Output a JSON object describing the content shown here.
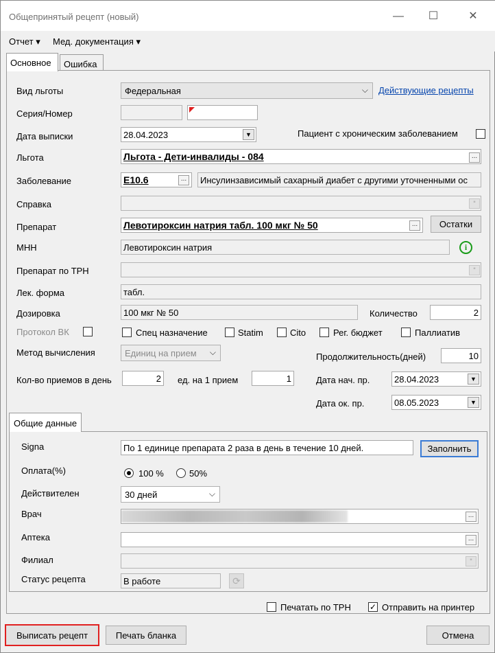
{
  "window": {
    "title": "Общепринятый рецепт (новый)",
    "minimize": "—",
    "maximize": "☐",
    "close": "✕"
  },
  "menu": {
    "report": "Отчет ▾",
    "med_docs": "Мед. документация ▾"
  },
  "tabs": [
    "Основное",
    "Ошибка"
  ],
  "form": {
    "benefit_type_label": "Вид льготы",
    "benefit_type_value": "Федеральная",
    "active_prescriptions_link": "Действующие рецепты",
    "series_number_label": "Серия/Номер",
    "series_value": "",
    "number_value": "",
    "issue_date_label": "Дата выписки",
    "issue_date_value": "28.04.2023",
    "chronic_label": "Пациент с хроническим заболеванием",
    "chronic_checked": false,
    "privilege_label": "Льгота",
    "privilege_value": "Льгота - Дети-инвалиды - 084",
    "disease_label": "Заболевание",
    "disease_code": "E10.6",
    "disease_name": "Инсулинзависимый сахарный диабет с другими уточненными ос",
    "certificate_label": "Справка",
    "certificate_value": "",
    "drug_label": "Препарат",
    "drug_value": "Левотироксин натрия табл. 100 мкг № 50",
    "stock_button": "Остатки",
    "mnn_label": "МНН",
    "mnn_value": "Левотироксин натрия",
    "info_icon": "i",
    "drug_trn_label": "Препарат по ТРН",
    "drug_trn_value": "",
    "dosage_form_label": "Лек. форма",
    "dosage_form_value": "табл.",
    "dosage_label": "Дозировка",
    "dosage_value": "100 мкг № 50",
    "quantity_label": "Количество",
    "quantity_value": "2",
    "vk_protocol_label": "Протокол ВК",
    "special_label": "Спец назначение",
    "statim_label": "Statim",
    "cito_label": "Cito",
    "reg_budget_label": "Рег. бюджет",
    "palliative_label": "Паллиатив",
    "calc_method_label": "Метод вычисления",
    "calc_method_value": "Единиц на прием",
    "duration_label": "Продолжительность(дней)",
    "duration_value": "10",
    "intakes_per_day_label": "Кол-во приемов в день",
    "intakes_per_day_value": "2",
    "units_per_intake_label": "ед. на 1 прием",
    "units_per_intake_value": "1",
    "start_date_label": "Дата нач. пр.",
    "start_date_value": "28.04.2023",
    "end_date_label": "Дата ок. пр.",
    "end_date_value": "08.05.2023"
  },
  "general": {
    "tab_label": "Общие данные",
    "signa_label": "Signa",
    "signa_value": "По 1 единице препарата 2 раза в день в течение 10 дней.",
    "fill_button": "Заполнить",
    "payment_label": "Оплата(%)",
    "payment_100": "100 %",
    "payment_50": "50%",
    "valid_label": "Действителен",
    "valid_value": "30 дней",
    "doctor_label": "Врач",
    "pharmacy_label": "Аптека",
    "pharmacy_value": "",
    "branch_label": "Филиал",
    "branch_value": "",
    "status_label": "Статус рецепта",
    "status_value": "В работе"
  },
  "footer": {
    "print_trn_label": "Печатать по ТРН",
    "print_trn_checked": false,
    "send_printer_label": "Отправить на принтер",
    "send_printer_checked": true,
    "issue_button": "Выписать рецепт",
    "print_form_button": "Печать бланка",
    "cancel_button": "Отмена"
  },
  "colors": {
    "link": "#0645ad",
    "info_icon": "#1a9c1a",
    "issue_border": "#e02020",
    "flag": "#e02020"
  }
}
